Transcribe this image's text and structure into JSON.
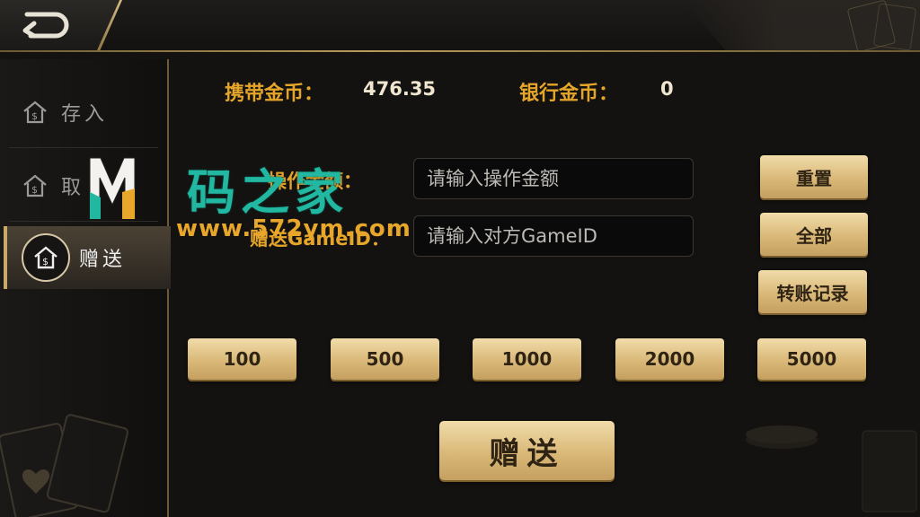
{
  "header": {
    "back_icon": "back-arrow-icon"
  },
  "sidebar": {
    "items": [
      {
        "label": "存入",
        "icon": "deposit-icon"
      },
      {
        "label": "取",
        "icon": "withdraw-icon"
      },
      {
        "label": "赠送",
        "icon": "gift-icon",
        "active": true
      }
    ]
  },
  "balances": {
    "carry_label": "携带金币：",
    "carry_value": "476.35",
    "bank_label": "银行金币：",
    "bank_value": "0"
  },
  "form": {
    "amount_label": "操作金额：",
    "amount_placeholder": "请输入操作金额",
    "gameid_label": "赠送GameID：",
    "gameid_placeholder": "请输入对方GameID"
  },
  "buttons": {
    "reset": "重置",
    "all": "全部",
    "record": "转账记录",
    "send": "赠送"
  },
  "chips": [
    "100",
    "500",
    "1000",
    "2000",
    "5000"
  ],
  "watermark": {
    "title": "码之家",
    "url": "www.572ym.com",
    "logo": "M"
  },
  "colors": {
    "gold": "#e5a52a",
    "button_gold": "#d9b878",
    "watermark_teal": "#21b7a0"
  }
}
